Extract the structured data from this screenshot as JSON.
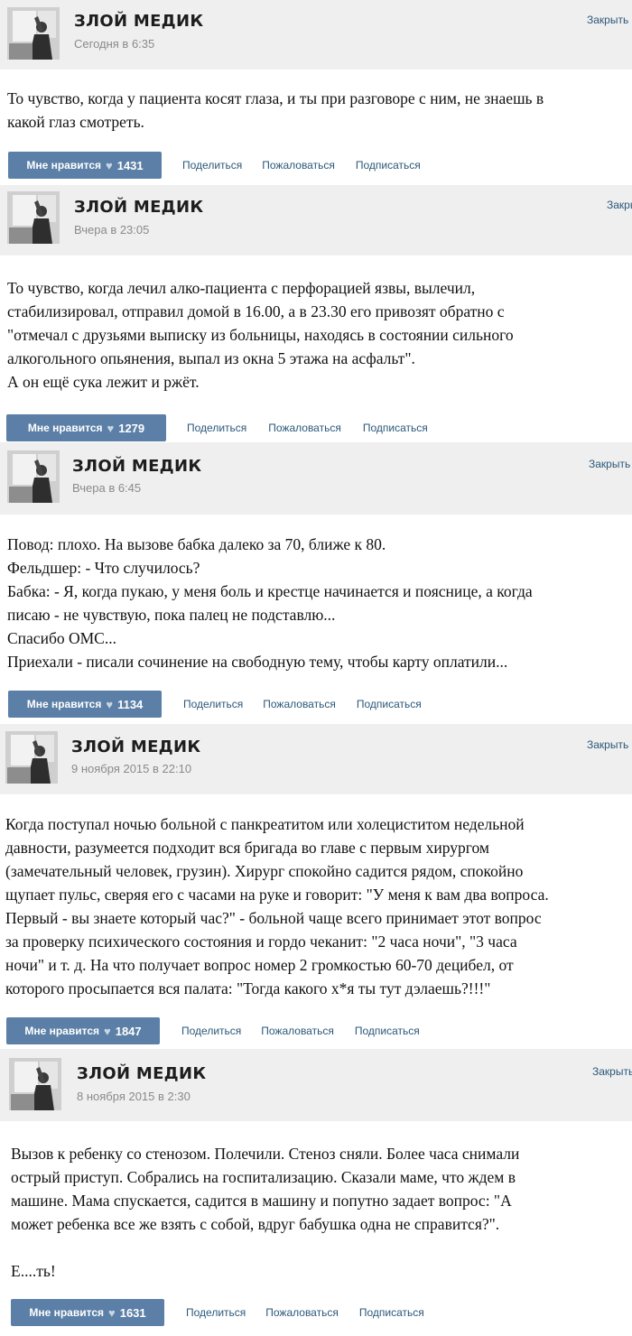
{
  "posts": [
    {
      "author": "ЗЛОЙ МЕДИК",
      "date": "Сегодня в 6:35",
      "close": "Закрыть",
      "text": "То чувство, когда у пациента косят глаза, и ты при разговоре с ним, не знаешь в\nкакой глаз смотреть.",
      "like_label": "Мне нравится",
      "like_count": "1431",
      "share": "Поделиться",
      "report": "Пожаловаться",
      "subscribe": "Подписаться"
    },
    {
      "author": "ЗЛОЙ МЕДИК",
      "date": "Вчера в 23:05",
      "close": "Закрыть",
      "text": "То чувство, когда лечил алко-пациента с перфорацией язвы, вылечил,\nстабилизировал, отправил домой в 16.00, а в 23.30 его привозят обратно с\n\"отмечал с друзьями выписку из больницы, находясь в состоянии сильного\nалкогольного опьянения, выпал из окна 5 этажа на асфальт\".\nА он ещё сука лежит и ржёт.",
      "like_label": "Мне нравится",
      "like_count": "1279",
      "share": "Поделиться",
      "report": "Пожаловаться",
      "subscribe": "Подписаться"
    },
    {
      "author": "ЗЛОЙ МЕДИК",
      "date": "Вчера в 6:45",
      "close": "Закрыть",
      "text": " Повод: плохо. На вызове бабка далеко за 70, ближе к 80.\nФельдшер: - Что случилось?\nБабка: - Я, когда пукаю, у меня боль и крестце начинается и пояснице, а когда\nписаю - не чувствую, пока палец не подставлю...\nСпасибо ОМС...\nПриехали - писали сочинение на свободную тему, чтобы карту оплатили...",
      "like_label": "Мне нравится",
      "like_count": "1134",
      "share": "Поделиться",
      "report": "Пожаловаться",
      "subscribe": "Подписаться"
    },
    {
      "author": "ЗЛОЙ МЕДИК",
      "date": "9 ноября 2015 в 22:10",
      "close": "Закрыть",
      "text": "Когда поступал ночью больной с панкреатитом или холециститом недельной\nдавности, разумеется подходит вся бригада во главе с первым хирургом\n(замечательный человек, грузин). Хирург спокойно садится рядом, спокойно\nщупает пульс, сверяя его с часами на руке и говорит: \"У меня к вам два вопроса.\nПервый - вы знаете который час?\" - больной чаще всего принимает этот вопрос\nза проверку психического состояния и гордо чеканит: \"2 часа ночи\", \"3 часа\nночи\" и т. д. На что получает вопрос номер 2 громкостью 60-70 децибел, от\nкоторого просыпается вся палата: \"Тогда какого х*я ты тут дэлаешь?!!!\"",
      "like_label": "Мне нравится",
      "like_count": "1847",
      "share": "Поделиться",
      "report": "Пожаловаться",
      "subscribe": "Подписаться"
    },
    {
      "author": "ЗЛОЙ МЕДИК",
      "date": "8 ноября 2015 в 2:30",
      "close": "Закрыть",
      "text": "Вызов к ребенку со стенозом. Полечили. Стеноз сняли. Более часа снимали\nострый приступ. Собрались на госпитализацию. Сказали маме, что ждем в\nмашине. Мама спускается, садится в машину и попутно задает вопрос: \"А\nможет ребенка все же взять с собой, вдруг бабушка одна не справится?\".\n\nЕ....ть!",
      "like_label": "Мне нравится",
      "like_count": "1631",
      "share": "Поделиться",
      "report": "Пожаловаться",
      "subscribe": "Подписаться"
    }
  ],
  "icons": {
    "like": "heart-icon",
    "avatar": "avatar-photo"
  },
  "colors": {
    "like_button": "#5b7fa6",
    "link": "#2b587a",
    "header_bg": "#efefef",
    "date": "#8a8a8a"
  }
}
